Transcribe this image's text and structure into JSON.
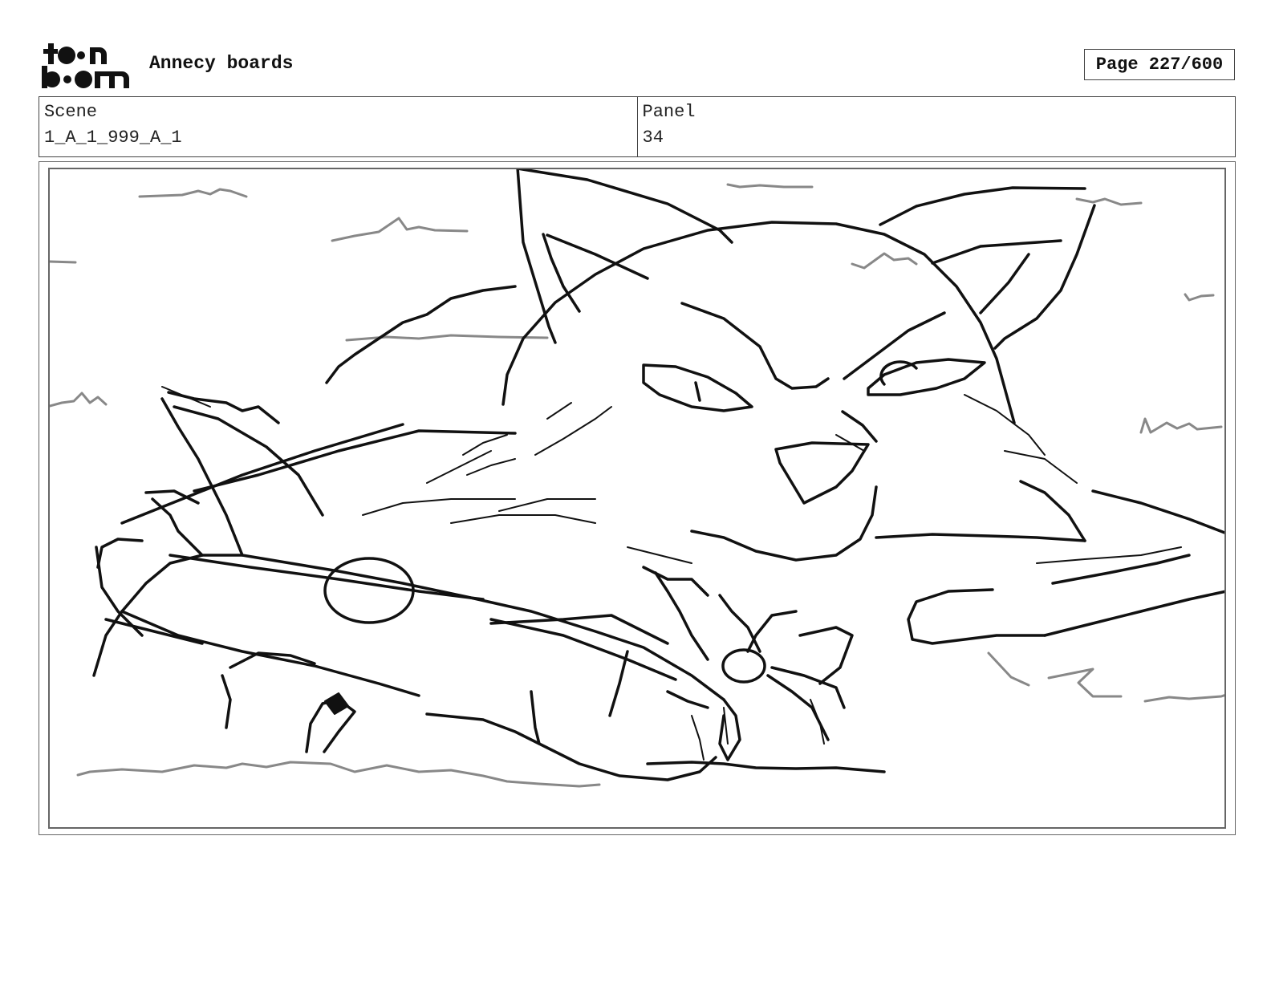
{
  "header": {
    "logo_text": "toonboom",
    "title": "Annecy boards",
    "page_indicator": "Page 227/600"
  },
  "info": {
    "scene_label": "Scene",
    "scene_value": "1_A_1_999_A_1",
    "panel_label": "Panel",
    "panel_value": "34"
  },
  "panel": {
    "image_name": "storyboard-sketch",
    "line_color": "#111111",
    "grass_color": "#888888"
  }
}
